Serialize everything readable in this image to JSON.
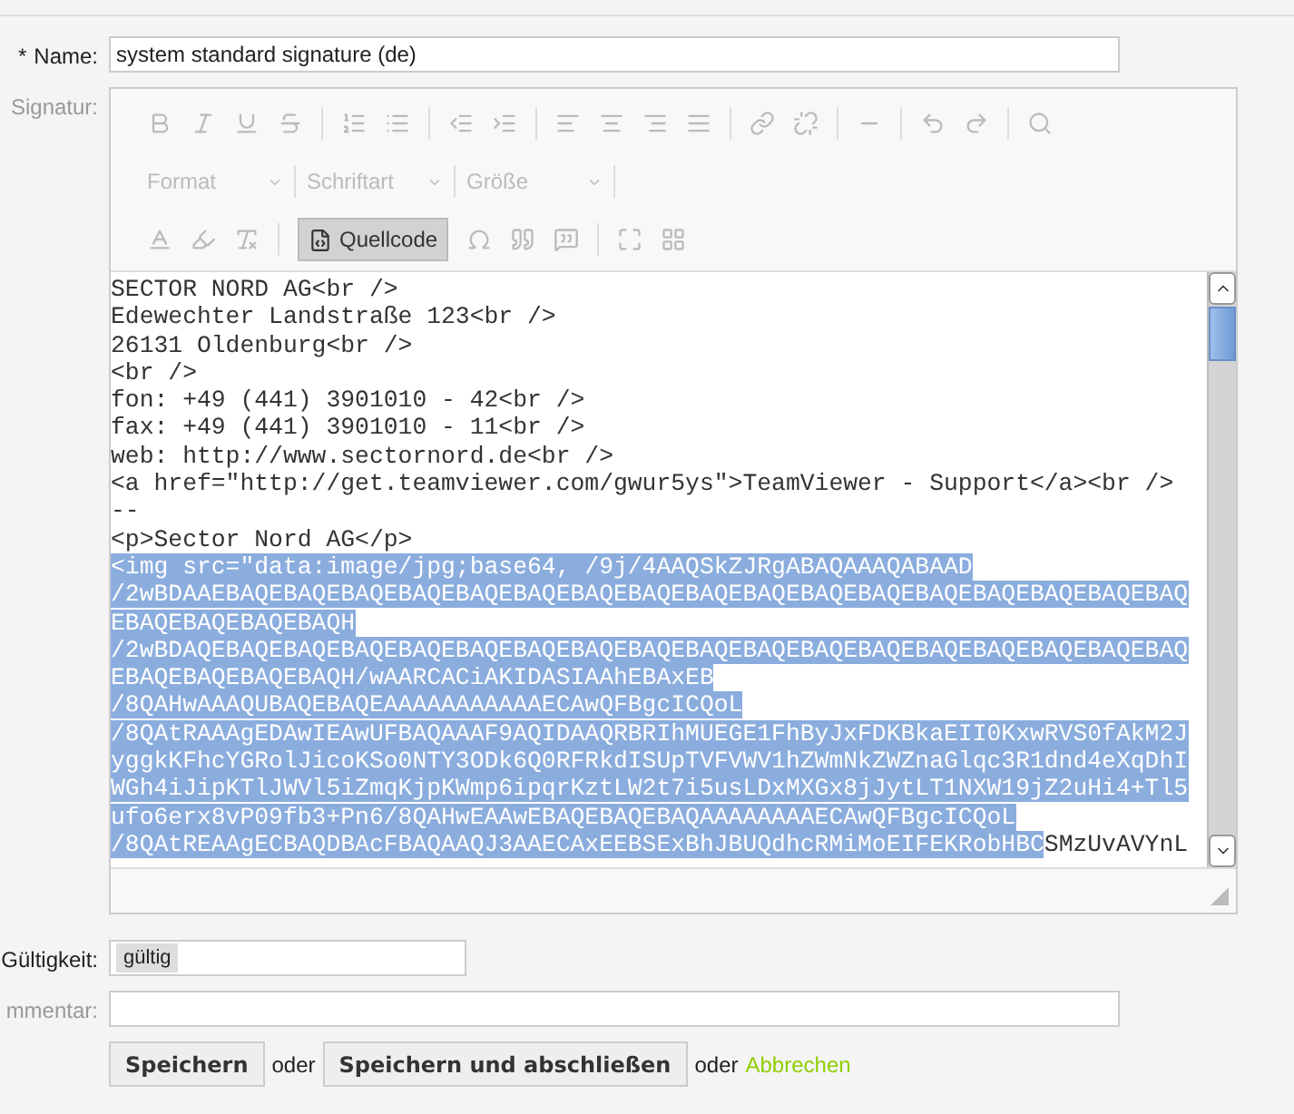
{
  "name_field": {
    "label": "Name:",
    "marker": "*",
    "required": true,
    "value": "system standard signature (de)"
  },
  "signature": {
    "label": "Signatur:",
    "required": false,
    "toolbar": {
      "disabled": true,
      "dropdowns": [
        {
          "label": "Format"
        },
        {
          "label": "Schriftart"
        },
        {
          "label": "Größe"
        }
      ],
      "source_button": {
        "label": "Quellcode",
        "selected": true
      }
    },
    "lines": [
      {
        "segments": [
          {
            "text": "SECTOR NORD AG<br />",
            "selected": false
          }
        ]
      },
      {
        "segments": [
          {
            "text": "Edewechter Landstraße 123<br />",
            "selected": false
          }
        ]
      },
      {
        "segments": [
          {
            "text": "26131 Oldenburg<br />",
            "selected": false
          }
        ]
      },
      {
        "segments": [
          {
            "text": "<br />",
            "selected": false
          }
        ]
      },
      {
        "segments": [
          {
            "text": "fon: +49 (441) 3901010 - 42<br />",
            "selected": false
          }
        ]
      },
      {
        "segments": [
          {
            "text": "fax: +49 (441) 3901010 - 11<br />",
            "selected": false
          }
        ]
      },
      {
        "segments": [
          {
            "text": "web: http://www.sectornord.de<br />",
            "selected": false
          }
        ]
      },
      {
        "segments": [
          {
            "text": "<a href=\"http://get.teamviewer.com/gwur5ys\">TeamViewer - Support</a><br />",
            "selected": false
          }
        ]
      },
      {
        "segments": [
          {
            "text": "--",
            "selected": false
          }
        ]
      },
      {
        "segments": [
          {
            "text": "<p>Sector Nord AG</p>",
            "selected": false
          }
        ]
      },
      {
        "segments": [
          {
            "text": "<img src=\"data:image/jpg;base64, /9j/4AAQSkZJRgABAQAAAQABAAD",
            "selected": true
          }
        ]
      },
      {
        "segments": [
          {
            "text": "/2wBDAAEBAQEBAQEBAQEBAQEBAQEBAQEBAQEBAQEBAQEBAQEBAQEBAQEBAQEBAQEBAQEBAQEBAQ",
            "selected": true
          }
        ]
      },
      {
        "segments": [
          {
            "text": "EBAQEBAQEBAQEBAQH",
            "selected": true
          }
        ]
      },
      {
        "segments": [
          {
            "text": "/2wBDAQEBAQEBAQEBAQEBAQEBAQEBAQEBAQEBAQEBAQEBAQEBAQEBAQEBAQEBAQEBAQEBAQEBAQ",
            "selected": true
          }
        ]
      },
      {
        "segments": [
          {
            "text": "EBAQEBAQEBAQEBAQH/wAARCACiAKIDASIAAhEBAxEB",
            "selected": true
          }
        ]
      },
      {
        "segments": [
          {
            "text": "/8QAHwAAAQUBAQEBAQEAAAAAAAAAAAECAwQFBgcICQoL",
            "selected": true
          }
        ]
      },
      {
        "segments": [
          {
            "text": "/8QAtRAAAgEDAwIEAwUFBAQAAAF9AQIDAAQRBRIhMUEGE1FhByJxFDKBkaEII0KxwRVS0fAkM2J",
            "selected": true
          }
        ]
      },
      {
        "segments": [
          {
            "text": "yggkKFhcYGRolJicoKSo0NTY3ODk6Q0RFRkdISUpTVFVWV1hZWmNkZWZnaGlqc3R1dnd4eXqDhI",
            "selected": true
          }
        ]
      },
      {
        "segments": [
          {
            "text": "WGh4iJipKTlJWVl5iZmqKjpKWmp6ipqrKztLW2t7i5usLDxMXGx8jJytLT1NXW19jZ2uHi4+Tl5",
            "selected": true
          }
        ]
      },
      {
        "segments": [
          {
            "text": "ufo6erx8vP09fb3+Pn6/8QAHwEAAwEBAQEBAQEBAQAAAAAAAAECAwQFBgcICQoL",
            "selected": true
          }
        ]
      },
      {
        "segments": [
          {
            "text": "/8QAtREAAgECBAQDBAcFBAQAAQJ3AAECAxEEBSExBhJBUQdhcRMiMoEIFEKRobHBC",
            "selected": true
          },
          {
            "text": "SMzUvAVYnL",
            "selected": false
          }
        ]
      }
    ]
  },
  "validity": {
    "label": "Gültigkeit:",
    "required": true,
    "tag": "gültig"
  },
  "comment": {
    "label": "mmentar:",
    "required": false
  },
  "actions": {
    "save": "Speichern",
    "or_1": "oder",
    "save_close": "Speichern und abschließen",
    "or_2": "oder",
    "cancel": "Abbrechen"
  }
}
